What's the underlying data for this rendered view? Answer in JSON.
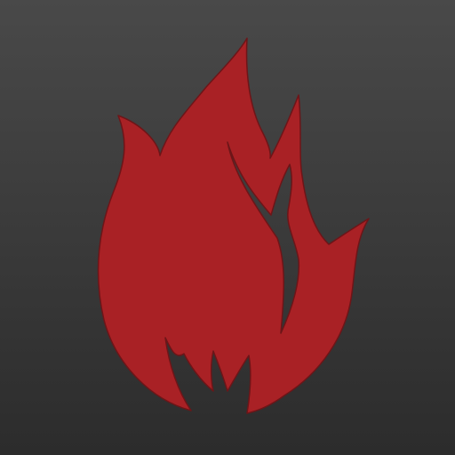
{
  "icon": {
    "name": "flame-icon",
    "flame_color": "#a92125",
    "edge_color": "#6d1518",
    "background_top": "#494949",
    "background_bottom": "#2c2c2c"
  }
}
